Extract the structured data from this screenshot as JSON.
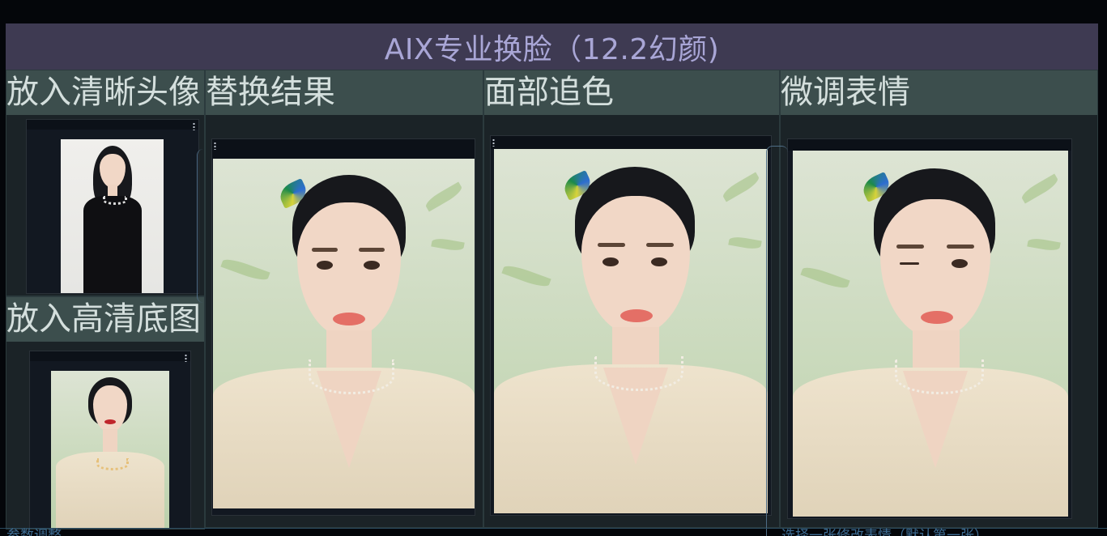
{
  "app_title": "AIX专业换脸（12.2幻颜)",
  "panels": {
    "face_input": {
      "title": "放入清晰头像"
    },
    "base_input": {
      "title": "放入高清底图"
    },
    "swap_result": {
      "title": "替换结果"
    },
    "face_color": {
      "title": "面部追色"
    },
    "expression": {
      "title": "微调表情"
    }
  },
  "footer": {
    "params": "参数调整",
    "expression_note": "选择一张修改表情（默认第一张）"
  },
  "colors": {
    "title_bg": "#3e3a52",
    "title_text": "#a9a6d6",
    "header_bg": "#3c4e4d",
    "panel_bg": "#1b2327"
  }
}
